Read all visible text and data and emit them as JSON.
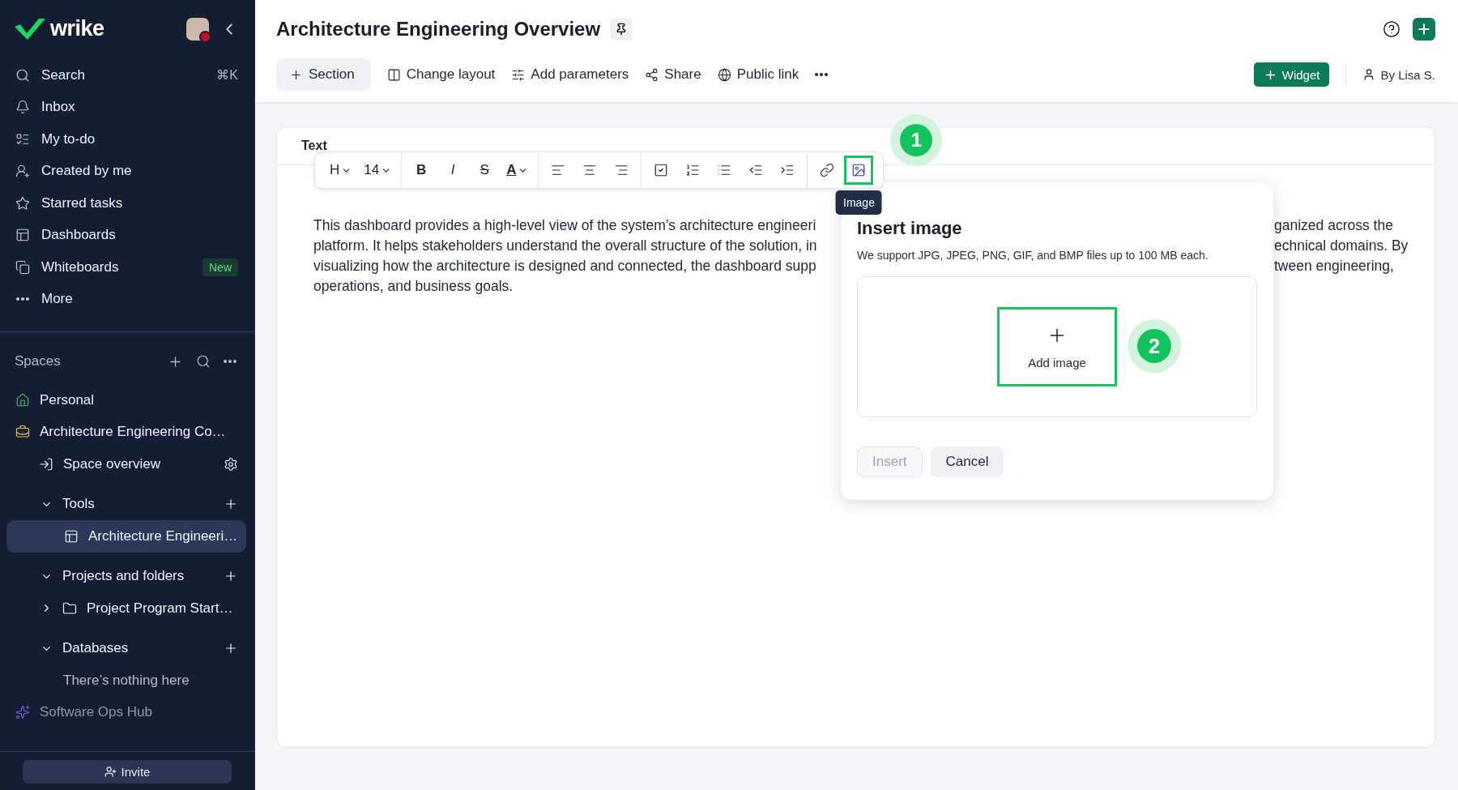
{
  "sidebar": {
    "logo": "wrike",
    "nav": [
      {
        "label": "Search",
        "shortcut": "⌘K"
      },
      {
        "label": "Inbox"
      },
      {
        "label": "My to-do"
      },
      {
        "label": "Created by me"
      },
      {
        "label": "Starred tasks"
      },
      {
        "label": "Dashboards"
      },
      {
        "label": "Whiteboards",
        "badge": "New"
      },
      {
        "label": "More"
      }
    ],
    "spaces": {
      "title": "Spaces",
      "items": [
        {
          "label": "Personal",
          "dimmed": false
        },
        {
          "label": "Architecture Engineering Co…",
          "dimmed": false,
          "children": [
            {
              "kind": "link",
              "label": "Space overview"
            },
            {
              "kind": "group",
              "label": "Tools",
              "expanded": true,
              "children": [
                {
                  "label": "Architecture Engineeri…",
                  "selected": true
                }
              ]
            },
            {
              "kind": "group",
              "label": "Projects and folders",
              "expanded": true,
              "children": [
                {
                  "label": "Project Program Start…",
                  "selected": false,
                  "expanded": false
                }
              ]
            },
            {
              "kind": "group",
              "label": "Databases",
              "expanded": true,
              "empty_text": "There’s nothing here"
            }
          ]
        },
        {
          "label": "Software Ops Hub",
          "dimmed": true
        }
      ]
    },
    "invite": "Invite"
  },
  "header": {
    "title": "Architecture Engineering Overview",
    "actions": [
      {
        "label": "Section",
        "kind": "filled"
      },
      {
        "label": "Change layout",
        "kind": "plain"
      },
      {
        "label": "Add parameters",
        "kind": "plain"
      },
      {
        "label": "Share",
        "kind": "plain"
      },
      {
        "label": "Public link",
        "kind": "plain"
      },
      {
        "kind": "more"
      }
    ],
    "widget_button": "Widget",
    "owner": "By Lisa S."
  },
  "widget": {
    "title": "Text",
    "toolbar": [
      [
        {
          "kind": "dropdown",
          "label": "H",
          "selected": false
        },
        {
          "kind": "dropdown",
          "label": "14",
          "selected": false
        }
      ],
      [
        {
          "kind": "glyph",
          "label": "B",
          "selected": false
        },
        {
          "kind": "glyph",
          "label": "I",
          "selected": false
        },
        {
          "kind": "glyph",
          "label": "S",
          "selected": false
        },
        {
          "kind": "dropdown",
          "label": "A",
          "selected": false
        }
      ],
      [
        {
          "kind": "icon",
          "selected": false
        },
        {
          "kind": "icon",
          "selected": false
        },
        {
          "kind": "icon",
          "selected": false
        }
      ],
      [
        {
          "kind": "icon",
          "selected": false
        },
        {
          "kind": "icon",
          "selected": false
        },
        {
          "kind": "icon",
          "selected": false
        },
        {
          "kind": "icon",
          "selected": false
        },
        {
          "kind": "icon",
          "selected": false
        }
      ],
      [
        {
          "kind": "icon",
          "selected": false
        },
        {
          "kind": "icon",
          "selected": true,
          "tooltip": "Image",
          "step": "1"
        }
      ]
    ],
    "text_left": [
      "This dashboard provides a high-level view of the system’s architecture engineeri",
      "platform. It helps stakeholders understand the overall structure of the solution, in",
      "visualizing how the architecture is designed and connected, the dashboard supp",
      "operations, and business goals."
    ],
    "text_right": [
      "ganized across the",
      "echnical domains. By",
      "tween engineering,"
    ]
  },
  "dialog": {
    "title": "Insert image",
    "description": "We support JPG, JPEG, PNG, GIF, and BMP files up to 100 MB each.",
    "add_label": "Add image",
    "step": "2",
    "buttons": [
      {
        "label": "Insert",
        "disabled": true
      },
      {
        "label": "Cancel",
        "disabled": false
      }
    ]
  }
}
